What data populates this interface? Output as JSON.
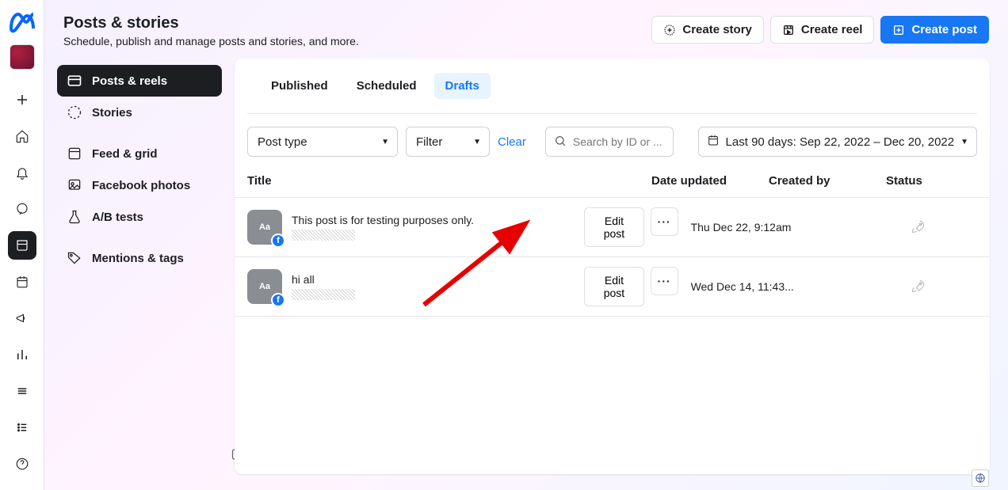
{
  "header": {
    "title": "Posts & stories",
    "subtitle": "Schedule, publish and manage posts and stories, and more.",
    "actions": {
      "create_story": "Create story",
      "create_reel": "Create reel",
      "create_post": "Create post"
    }
  },
  "sidebar": {
    "items": [
      {
        "label": "Posts & reels",
        "icon": "posts-icon",
        "active": true
      },
      {
        "label": "Stories",
        "icon": "stories-icon",
        "active": false
      },
      {
        "label": "Feed & grid",
        "icon": "feed-icon",
        "active": false
      },
      {
        "label": "Facebook photos",
        "icon": "photos-icon",
        "active": false
      },
      {
        "label": "A/B tests",
        "icon": "flask-icon",
        "active": false
      },
      {
        "label": "Mentions & tags",
        "icon": "tag-icon",
        "active": false
      }
    ]
  },
  "tabs": [
    {
      "label": "Published",
      "active": false
    },
    {
      "label": "Scheduled",
      "active": false
    },
    {
      "label": "Drafts",
      "active": true
    }
  ],
  "filters": {
    "post_type": "Post type",
    "filter": "Filter",
    "clear": "Clear",
    "search_placeholder": "Search by ID or ...",
    "date_range": "Last 90 days: Sep 22, 2022 – Dec 20, 2022"
  },
  "columns": {
    "title": "Title",
    "date_updated": "Date updated",
    "created_by": "Created by",
    "status": "Status"
  },
  "rows": [
    {
      "title": "This post is for testing purposes only.",
      "edit_label": "Edit post",
      "date": "Thu Dec 22, 9:12am"
    },
    {
      "title": "hi all",
      "edit_label": "Edit post",
      "date": "Wed Dec 14, 11:43..."
    }
  ]
}
